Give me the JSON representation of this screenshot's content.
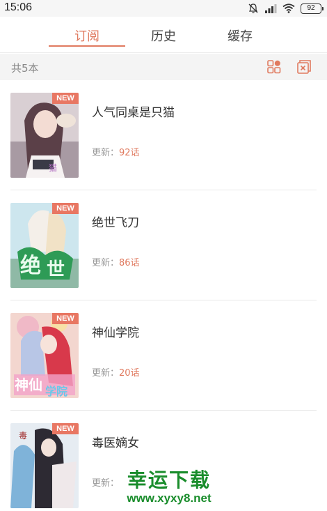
{
  "status_bar": {
    "time": "15:06",
    "battery": "92"
  },
  "tabs": [
    {
      "label": "订阅",
      "active": true
    },
    {
      "label": "历史",
      "active": false
    },
    {
      "label": "缓存",
      "active": false
    }
  ],
  "header": {
    "count": "共5本"
  },
  "books": [
    {
      "title": "人气同桌是只猫",
      "badge": "NEW",
      "update_prefix": "更新：",
      "update_value": "92话"
    },
    {
      "title": "绝世飞刀",
      "badge": "NEW",
      "update_prefix": "更新：",
      "update_value": "86话"
    },
    {
      "title": "神仙学院",
      "badge": "NEW",
      "update_prefix": "更新：",
      "update_value": "20话"
    },
    {
      "title": "毒医嫡女",
      "badge": "NEW",
      "update_prefix": "更新：",
      "update_value": ""
    }
  ],
  "watermark": {
    "main": "幸运下载",
    "url": "www.xyxy8.net"
  },
  "colors": {
    "accent": "#e07a5f",
    "badge": "#e87763",
    "watermark": "#1a8d2c"
  }
}
